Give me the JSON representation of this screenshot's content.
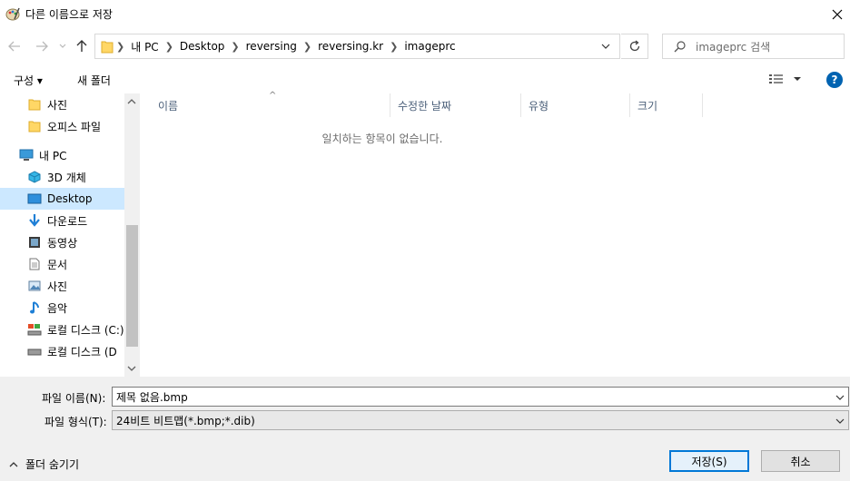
{
  "window": {
    "title": "다른 이름으로 저장",
    "icon": "paint-icon"
  },
  "nav": {
    "path": [
      "내 PC",
      "Desktop",
      "reversing",
      "reversing.kr",
      "imageprc"
    ],
    "search_placeholder": "imageprc 검색"
  },
  "toolbar": {
    "organize_label": "구성 ▾",
    "new_folder_label": "새 폴더",
    "help_label": "?"
  },
  "sidebar": {
    "items": [
      {
        "label": "사진",
        "icon": "folder-icon"
      },
      {
        "label": "오피스 파일",
        "icon": "folder-icon"
      },
      {
        "label": "내 PC",
        "icon": "pc-icon"
      },
      {
        "label": "3D 개체",
        "icon": "3d-objects-icon"
      },
      {
        "label": "Desktop",
        "icon": "desktop-icon"
      },
      {
        "label": "다운로드",
        "icon": "download-icon"
      },
      {
        "label": "동영상",
        "icon": "video-icon"
      },
      {
        "label": "문서",
        "icon": "document-icon"
      },
      {
        "label": "사진",
        "icon": "pictures-icon"
      },
      {
        "label": "음악",
        "icon": "music-icon"
      },
      {
        "label": "로컬 디스크 (C:)",
        "icon": "drive-icon"
      },
      {
        "label": "로컬 디스크 (D",
        "icon": "drive-icon"
      }
    ]
  },
  "filelist": {
    "columns": [
      "이름",
      "수정한 날짜",
      "유형",
      "크기"
    ],
    "empty_message": "일치하는 항목이 없습니다."
  },
  "form": {
    "filename_label": "파일 이름(N):",
    "filename_value": "제목 없음.bmp",
    "filetype_label": "파일 형식(T):",
    "filetype_value": "24비트 비트맵(*.bmp;*.dib)",
    "hide_folders_label": "폴더 숨기기",
    "save_label": "저장(S)",
    "cancel_label": "취소"
  },
  "colors": {
    "accent": "#0078d7",
    "selection": "#cce8ff",
    "folder": "#ffd766",
    "help": "#0063b1"
  }
}
